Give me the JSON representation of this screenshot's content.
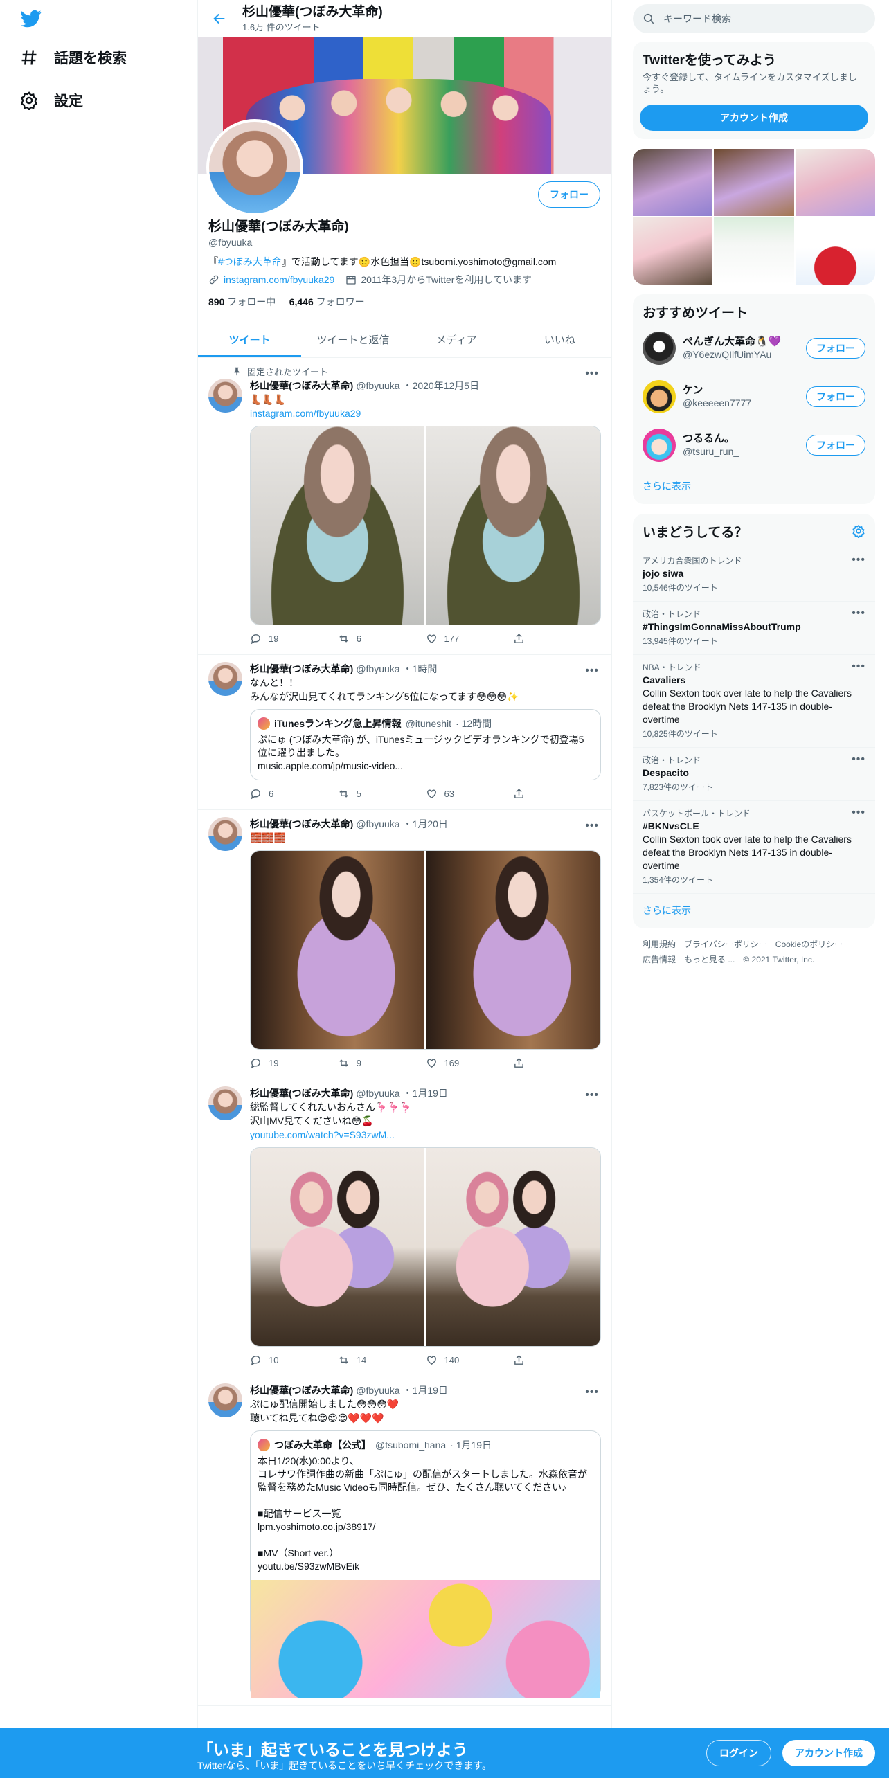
{
  "nav": {
    "explore": "話題を検索",
    "settings": "設定"
  },
  "header": {
    "title": "杉山優華(つぼみ大革命)",
    "tweet_count": "1.6万 件のツイート"
  },
  "profile": {
    "name": "杉山優華(つぼみ大革命)",
    "handle": "@fbyuuka",
    "follow_button": "フォロー",
    "bio_prefix": "『",
    "bio_tag": "#つぼみ大革命",
    "bio_rest": "』で活動してます🙂水色担当🙂tsubomi.yoshimoto@gmail.com",
    "link": "instagram.com/fbyuuka29",
    "joined": "2011年3月からTwitterを利用しています",
    "following_count": "890",
    "following_label": "フォロー中",
    "followers_count": "6,446",
    "followers_label": "フォロワー"
  },
  "tabs": [
    "ツイート",
    "ツイートと返信",
    "メディア",
    "いいね"
  ],
  "tweets": [
    {
      "pinned": "固定されたツイート",
      "name": "杉山優華(つぼみ大革命)",
      "handle": "@fbyuuka",
      "date": "・2020年12月5日",
      "text": "👢👢👢",
      "link": "instagram.com/fbyuuka29",
      "replies": "19",
      "retweets": "6",
      "likes": "177"
    },
    {
      "name": "杉山優華(つぼみ大革命)",
      "handle": "@fbyuuka",
      "date": "・1時間",
      "text": "なんと！！\nみんなが沢山見てくれてランキング5位になってます😳😳😳✨",
      "quote_name": "iTunesランキング急上昇情報",
      "quote_handle": "@ituneshit",
      "quote_date": "· 12時間",
      "quote_text": "ぷにゅ (つぼみ大革命) が、iTunesミュージックビデオランキングで初登場5位に躍り出ました。\nmusic.apple.com/jp/music-video...",
      "replies": "6",
      "retweets": "5",
      "likes": "63"
    },
    {
      "name": "杉山優華(つぼみ大革命)",
      "handle": "@fbyuuka",
      "date": "・1月20日",
      "text": "🧱🧱🧱",
      "replies": "19",
      "retweets": "9",
      "likes": "169"
    },
    {
      "name": "杉山優華(つぼみ大革命)",
      "handle": "@fbyuuka",
      "date": "・1月19日",
      "text": "総監督してくれたいおんさん🦩🦩🦩\n沢山MV見てくださいね😳🍒",
      "link": "youtube.com/watch?v=S93zwM...",
      "replies": "10",
      "retweets": "14",
      "likes": "140"
    },
    {
      "name": "杉山優華(つぼみ大革命)",
      "handle": "@fbyuuka",
      "date": "・1月19日",
      "text": "ぷにゅ配信開始しました😳😳😳❤️\n聴いてね見てね😍😍😍❤️❤️❤️",
      "quote_name": "つぼみ大革命【公式】",
      "quote_handle": "@tsubomi_hana",
      "quote_date": "· 1月19日",
      "quote_text": "本日1/20(水)0:00より、\nコレサワ作詞作曲の新曲「ぷにゅ」の配信がスタートしました。水森依音が監督を務めたMusic Videoも同時配信。ぜひ、たくさん聴いてください♪\n\n■配信サービス一覧\nlpm.yoshimoto.co.jp/38917/\n\n■MV（Short ver.）\nyoutu.be/S93zwMBvEik"
    }
  ],
  "right": {
    "search_placeholder": "キーワード検索",
    "join_title": "Twitterを使ってみよう",
    "join_sub": "今すぐ登録して、タイムラインをカスタマイズしましょう。",
    "join_button": "アカウント作成",
    "who_title": "おすすめツイート",
    "suggestions": [
      {
        "name": "ぺんぎん大革命🐧💜",
        "handle": "@Y6ezwQIlfUimYAu",
        "button": "フォロー"
      },
      {
        "name": "ケン",
        "handle": "@keeeeen7777",
        "button": "フォロー"
      },
      {
        "name": "つるるん。",
        "handle": "@tsuru_run_",
        "button": "フォロー"
      }
    ],
    "show_more": "さらに表示",
    "trends_title": "いまどうしてる？",
    "trends": [
      {
        "category": "アメリカ合衆国のトレンド",
        "name": "jojo siwa",
        "desc": "",
        "count": "10,546件のツイート"
      },
      {
        "category": "政治・トレンド",
        "name": "#ThingsImGonnaMissAboutTrump",
        "desc": "",
        "count": "13,945件のツイート"
      },
      {
        "category": "NBA・トレンド",
        "name": "Cavaliers",
        "desc": "Collin Sexton took over late to help the Cavaliers defeat the Brooklyn Nets 147-135 in double-overtime",
        "count": "10,825件のツイート"
      },
      {
        "category": "政治・トレンド",
        "name": "Despacito",
        "desc": "",
        "count": "7,823件のツイート"
      },
      {
        "category": "バスケットボール・トレンド",
        "name": "#BKNvsCLE",
        "desc": "Collin Sexton took over late to help the Cavaliers defeat the Brooklyn Nets 147-135 in double-overtime",
        "count": "1,354件のツイート"
      }
    ],
    "footer_links": [
      "利用規約",
      "プライバシーポリシー",
      "Cookieのポリシー",
      "広告情報",
      "もっと見る ...",
      "© 2021 Twitter, Inc."
    ]
  },
  "bottom": {
    "title": "「いま」起きていることを見つけよう",
    "subtitle": "Twitterなら、「いま」起きていることをいち早くチェックできます。",
    "login": "ログイン",
    "signup": "アカウント作成"
  },
  "colors": {
    "accent": "#1d9bf0",
    "text": "#0f1419",
    "muted": "#536471"
  }
}
